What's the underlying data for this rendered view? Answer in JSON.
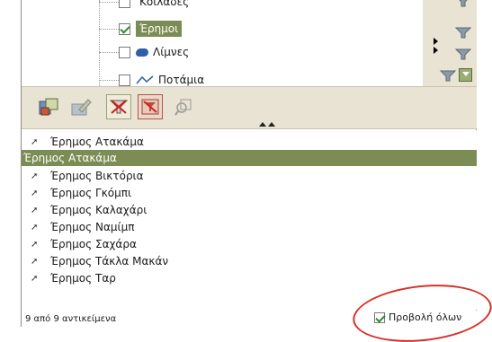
{
  "tree": {
    "items": [
      {
        "label": "Κοιλάδες",
        "checked": false,
        "icon": "none"
      },
      {
        "label": "Έρημοι",
        "checked": true,
        "selected": true,
        "icon": "none"
      },
      {
        "label": "Λίμνες",
        "checked": false,
        "icon": "lake-icon"
      },
      {
        "label": "Ποτάμια",
        "checked": false,
        "icon": "river-icon"
      }
    ]
  },
  "toolbar": {
    "buttons": [
      "layer-properties-icon",
      "edit-icon",
      "filter-icon",
      "clear-filter-icon",
      "zoom-to-icon"
    ]
  },
  "list": {
    "items": [
      {
        "label": "Έρημος Ατακάμα",
        "selected": false
      },
      {
        "label": "Έρημος Ατακάμα",
        "selected": true
      },
      {
        "label": "Έρημος Βικτόρια",
        "selected": false
      },
      {
        "label": "Έρημος Γκόμπι",
        "selected": false
      },
      {
        "label": "Έρημος Καλαχάρι",
        "selected": false
      },
      {
        "label": "Έρημος Ναμίμπ",
        "selected": false
      },
      {
        "label": "Έρημος Σαχάρα",
        "selected": false
      },
      {
        "label": "Έρημος Τάκλα Μακάν",
        "selected": false
      },
      {
        "label": "Έρημος Ταρ",
        "selected": false
      }
    ]
  },
  "status": {
    "count_text": "9 από 9 αντικείμενα",
    "show_all_label": "Προβολή όλων",
    "show_all_checked": true
  },
  "colors": {
    "selection": "#7c8c55",
    "toolbar_bg": "#e8e3d3",
    "annotation_circle": "#d8302a"
  }
}
